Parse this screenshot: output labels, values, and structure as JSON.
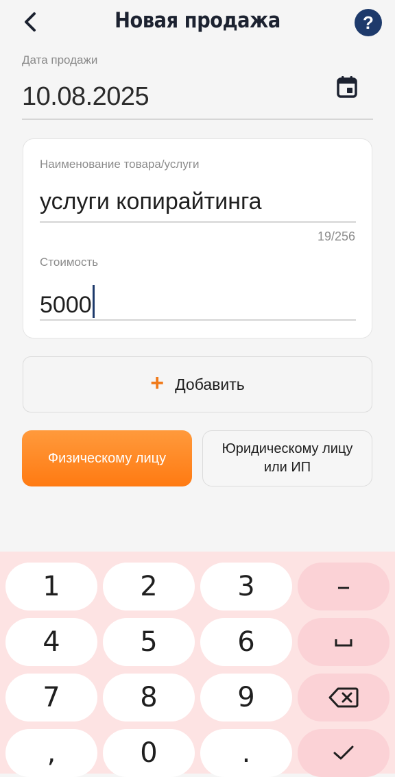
{
  "header": {
    "title": "Новая продажа",
    "help": "?"
  },
  "date": {
    "label": "Дата продажи",
    "value": "10.08.2025"
  },
  "product": {
    "label": "Наименование товара/услуги",
    "value": "услуги копирайтинга",
    "counter": "19/256"
  },
  "price": {
    "label": "Стоимость",
    "value": "5000"
  },
  "add_button": {
    "icon": "+",
    "label": "Добавить"
  },
  "buyer_type": {
    "individual": "Физическому лицу",
    "legal": "Юридическому лицу или ИП"
  },
  "keyboard": {
    "keys": [
      "1",
      "2",
      "3",
      "–",
      "4",
      "5",
      "6",
      "␣",
      "7",
      "8",
      "9",
      "backspace",
      ",",
      "0",
      ".",
      "done"
    ]
  },
  "colors": {
    "accent": "#ff7a12",
    "brand": "#1e3a6b",
    "keyboard_bg": "#fde3e3"
  }
}
